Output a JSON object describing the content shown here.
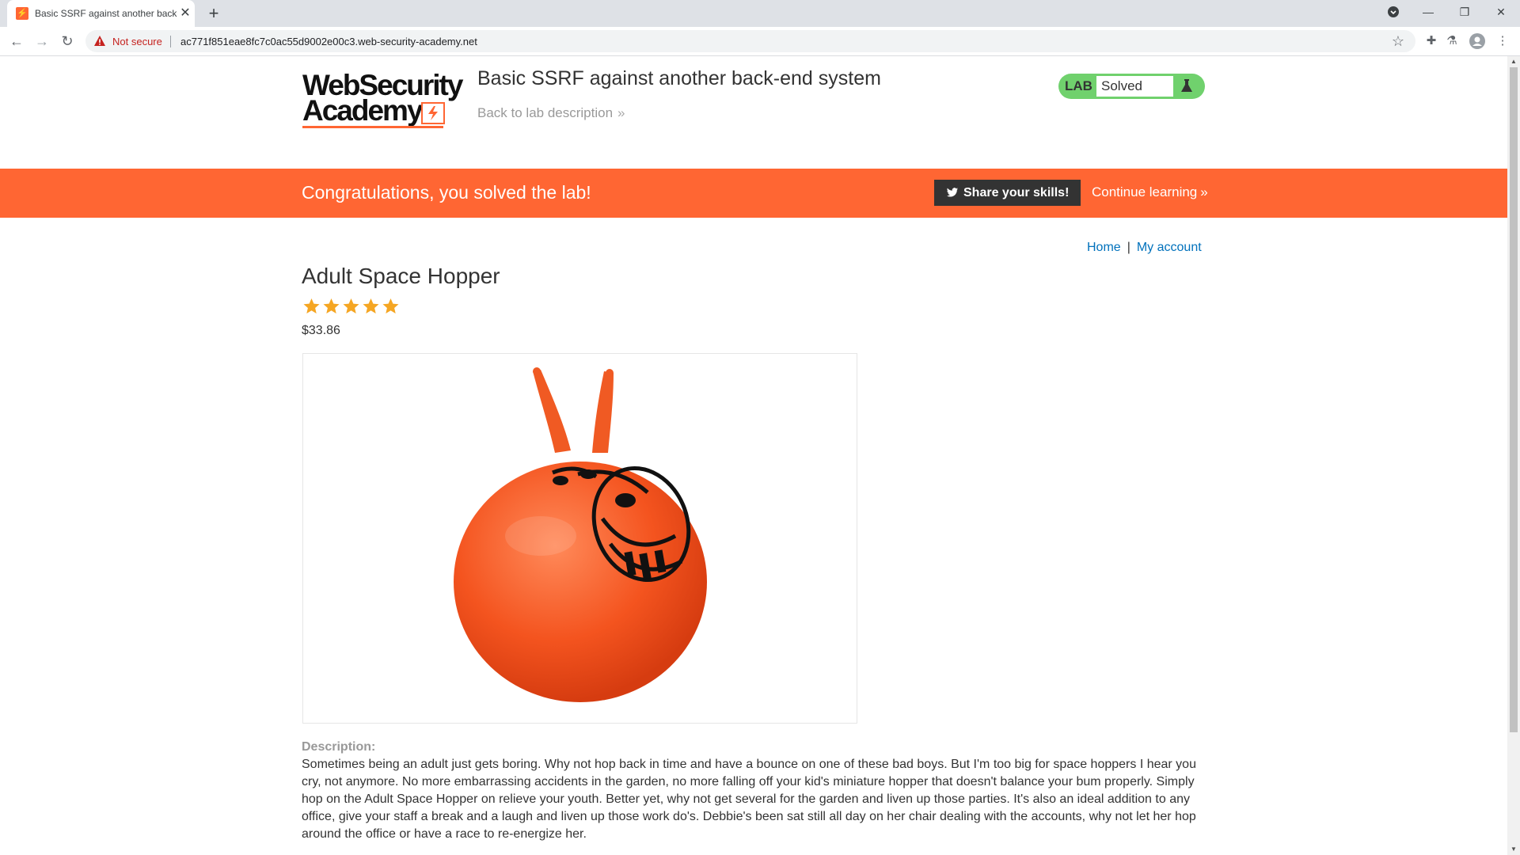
{
  "browser": {
    "tab_title": "Basic SSRF against another back-end system",
    "tab_favicon": "websecurity-favicon",
    "new_tab_icon": "plus-icon",
    "not_secure_label": "Not secure",
    "url": "ac771f851eae8fc7c0ac55d9002e00c3.web-security-academy.net"
  },
  "header": {
    "logo_line1": "WebSecurity",
    "logo_line2": "Academy",
    "lab_title": "Basic SSRF against another back-end system",
    "back_link": "Back to lab description",
    "lab_badge": "LAB",
    "lab_status": "Solved"
  },
  "banner": {
    "text": "Congratulations, you solved the lab!",
    "share_label": "Share your skills!",
    "continue_label": "Continue learning"
  },
  "nav": {
    "home": "Home",
    "separator": "|",
    "account": "My account"
  },
  "product": {
    "title": "Adult Space Hopper",
    "rating": 5,
    "rating_max": 5,
    "price": "$33.86",
    "description_label": "Description:",
    "description": "Sometimes being an adult just gets boring. Why not hop back in time and have a bounce on one of these bad boys. But I'm too big for space hoppers I hear you cry, not anymore. No more embarrassing accidents in the garden, no more falling off your kid's miniature hopper that doesn't balance your bum properly. Simply hop on the Adult Space Hopper on relieve your youth. Better yet, why not get several for the garden and liven up those parties. It's also an ideal addition to any office, give your staff a break and a laugh and liven up those work do's. Debbie's been sat still all day on her chair dealing with the accounts, why not let her hop around the office or have a race to re-energize her."
  },
  "colors": {
    "accent": "#ff6633",
    "lab_green": "#70d16d",
    "link_blue": "#0071bc",
    "star_gold": "#f5a623"
  }
}
